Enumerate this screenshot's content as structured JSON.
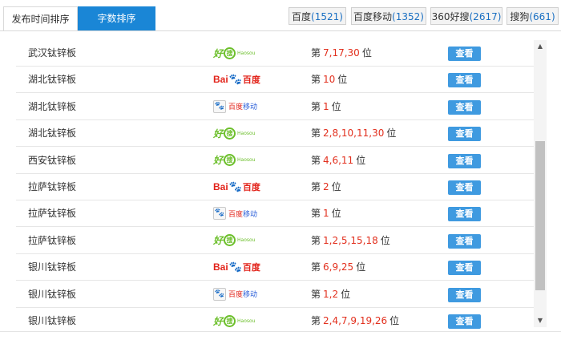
{
  "tabs": {
    "time_sort": "发布时间排序",
    "word_sort": "字数排序"
  },
  "engines": [
    {
      "label": "百度",
      "count": "(1521)"
    },
    {
      "label": "百度移动",
      "count": "(1352)"
    },
    {
      "label": "360好搜",
      "count": "(2617)"
    },
    {
      "label": "搜狗",
      "count": "(661)"
    }
  ],
  "rank_prefix": "第",
  "rank_suffix": "位",
  "view_label": "查看",
  "logos": {
    "haosou": {
      "text": "好",
      "q": "搜",
      "sub": "Haosou"
    },
    "baidu": {
      "bai": "Bai",
      "paw": "🐾",
      "cn": "百度"
    },
    "baidu_mobile": {
      "box": "🐾",
      "red": "百度",
      "blue": "移动"
    }
  },
  "rows": [
    {
      "keyword": "武汉钛锌板",
      "engine": "haosou",
      "ranks": "7,17,30"
    },
    {
      "keyword": "湖北钛锌板",
      "engine": "baidu",
      "ranks": "10"
    },
    {
      "keyword": "湖北钛锌板",
      "engine": "baidu_mobile",
      "ranks": "1"
    },
    {
      "keyword": "湖北钛锌板",
      "engine": "haosou",
      "ranks": "2,8,10,11,30"
    },
    {
      "keyword": "西安钛锌板",
      "engine": "haosou",
      "ranks": "4,6,11"
    },
    {
      "keyword": "拉萨钛锌板",
      "engine": "baidu",
      "ranks": "2"
    },
    {
      "keyword": "拉萨钛锌板",
      "engine": "baidu_mobile",
      "ranks": "1"
    },
    {
      "keyword": "拉萨钛锌板",
      "engine": "haosou",
      "ranks": "1,2,5,15,18"
    },
    {
      "keyword": "银川钛锌板",
      "engine": "baidu",
      "ranks": "6,9,25"
    },
    {
      "keyword": "银川钛锌板",
      "engine": "baidu_mobile",
      "ranks": "1,2"
    },
    {
      "keyword": "银川钛锌板",
      "engine": "haosou",
      "ranks": "2,4,7,9,19,26"
    }
  ],
  "colors": {
    "accent": "#1a86d6",
    "rank": "#e2301e",
    "button": "#3f9ae0"
  }
}
